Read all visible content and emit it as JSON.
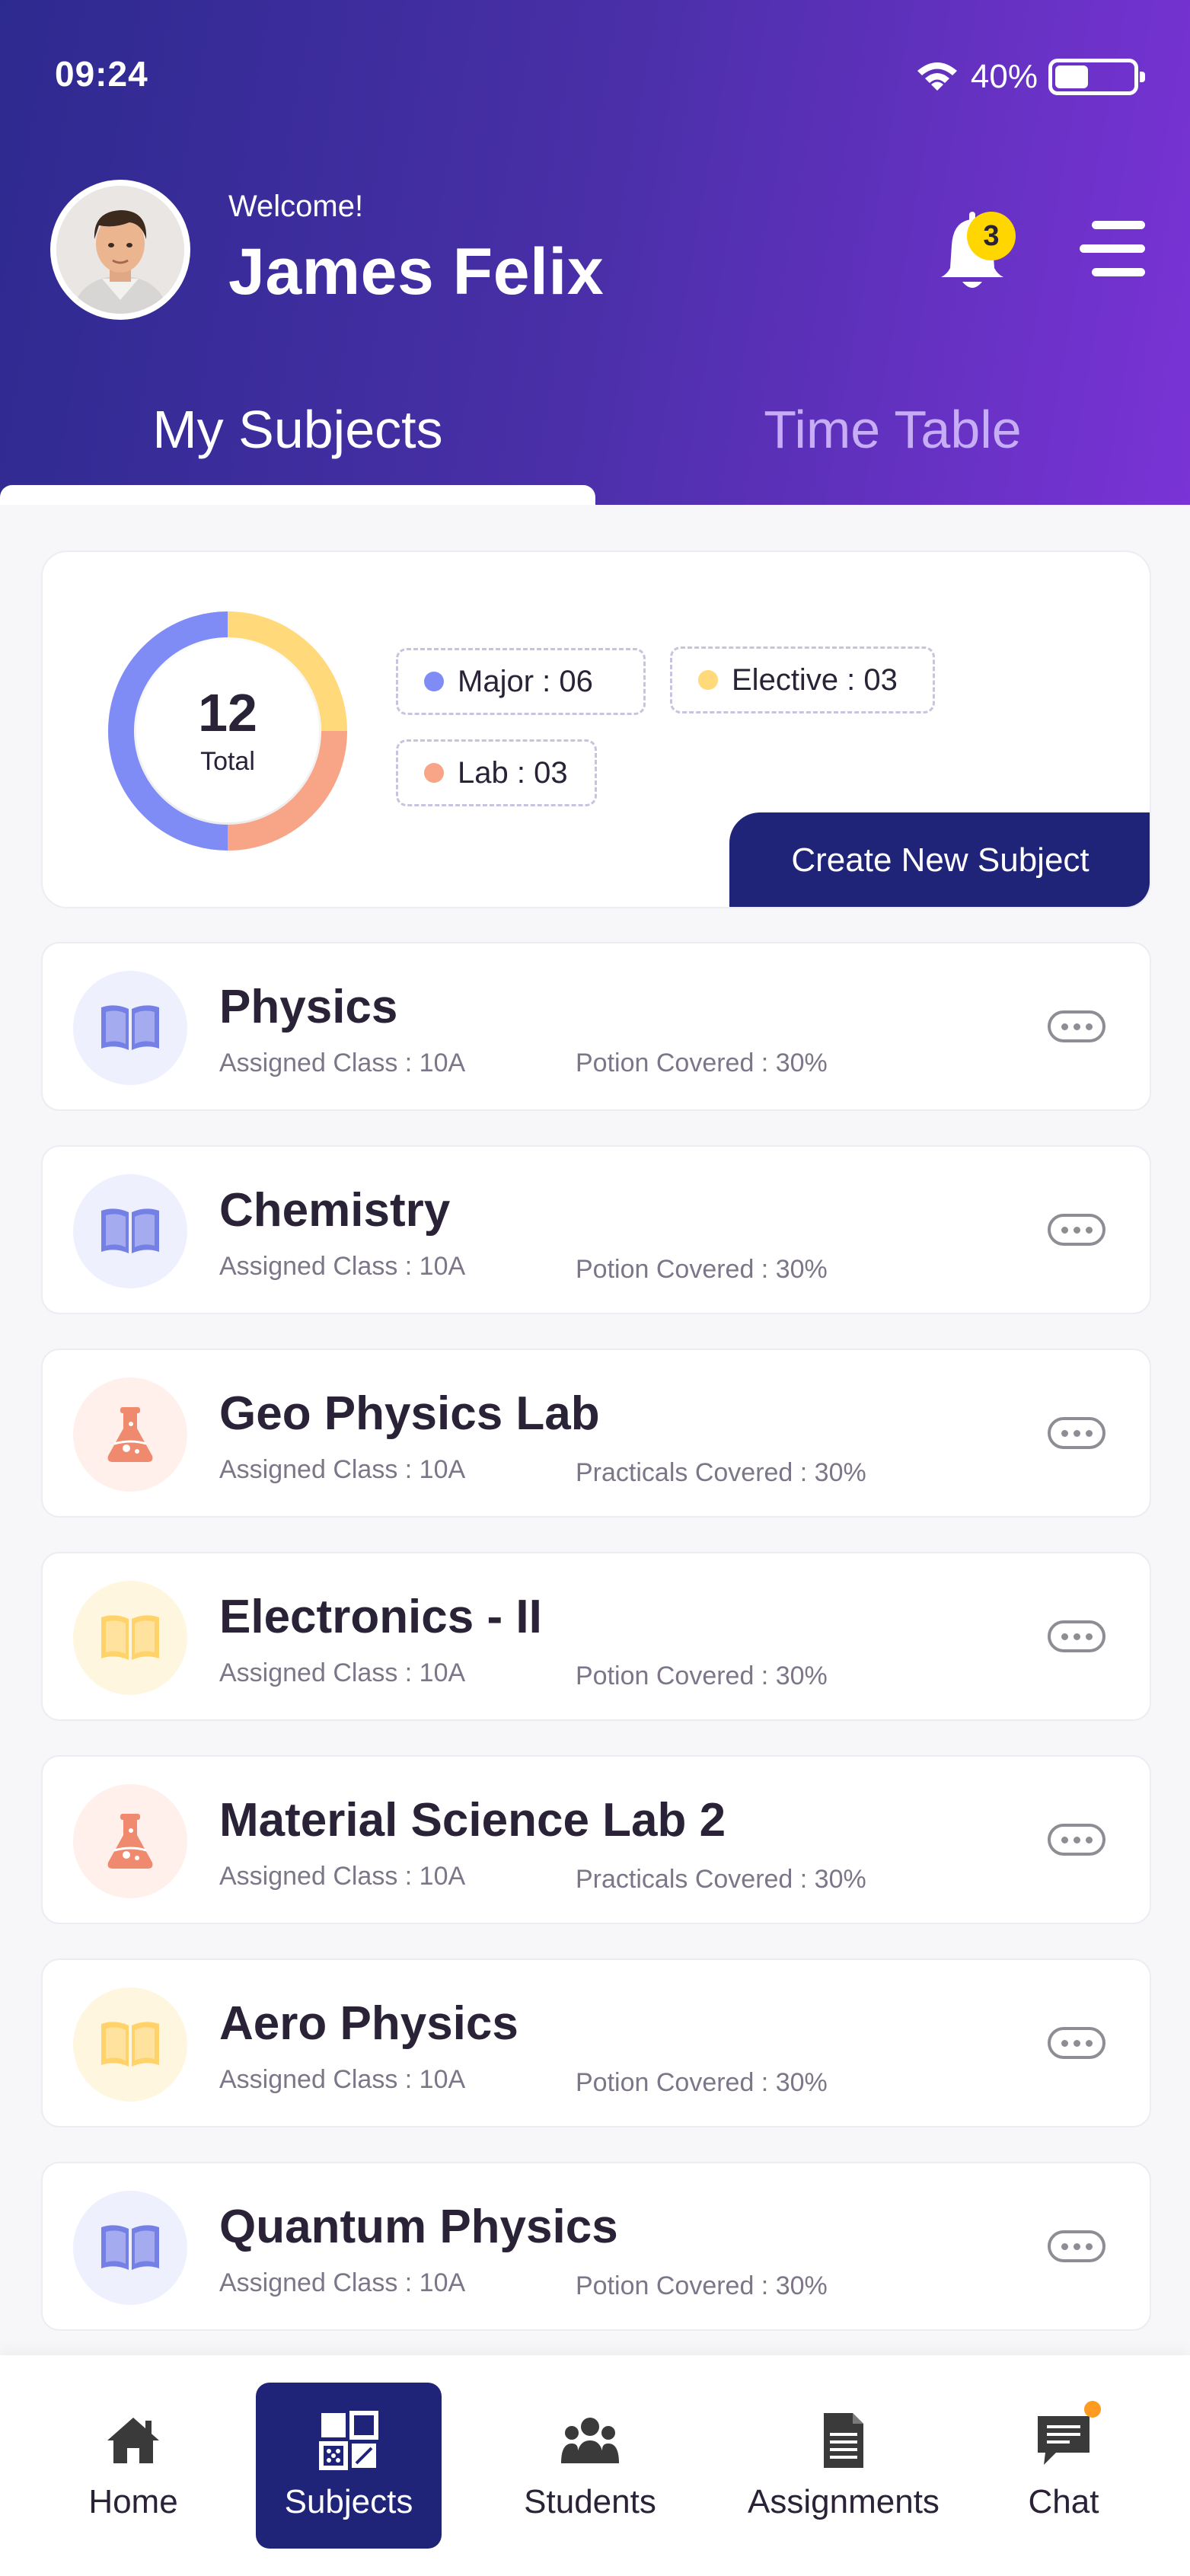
{
  "status": {
    "time": "09:24",
    "battery": "40%",
    "battery_level": 0.4
  },
  "profile": {
    "welcome": "Welcome!",
    "name": "James Felix",
    "notification_count": "3"
  },
  "tabs": [
    {
      "label": "My Subjects",
      "active": true
    },
    {
      "label": "Time Table",
      "active": false
    }
  ],
  "summary": {
    "total": "12",
    "total_label": "Total",
    "legend": [
      {
        "label": "Major : 06",
        "color": "#7f8cf6",
        "value": 6
      },
      {
        "label": "Elective : 03",
        "color": "#ffd97a",
        "value": 3
      },
      {
        "label": "Lab : 03",
        "color": "#f7a487",
        "value": 3
      }
    ],
    "create_label": "Create New Subject"
  },
  "subjects": [
    {
      "name": "Physics",
      "class": "Assigned Class : 10A",
      "progress": "Potion Covered : 30%",
      "icon": "book-icon",
      "theme": "blue"
    },
    {
      "name": "Chemistry",
      "class": "Assigned Class : 10A",
      "progress": "Potion Covered : 30%",
      "icon": "book-icon",
      "theme": "blue"
    },
    {
      "name": "Geo Physics Lab",
      "class": "Assigned Class : 10A",
      "progress": "Practicals Covered : 30%",
      "icon": "flask-icon",
      "theme": "orange"
    },
    {
      "name": "Electronics - II",
      "class": "Assigned Class : 10A",
      "progress": "Potion Covered : 30%",
      "icon": "book-icon",
      "theme": "yellow"
    },
    {
      "name": "Material Science Lab 2",
      "class": "Assigned Class : 10A",
      "progress": "Practicals Covered : 30%",
      "icon": "flask-icon",
      "theme": "orange"
    },
    {
      "name": "Aero Physics",
      "class": "Assigned Class : 10A",
      "progress": "Potion Covered : 30%",
      "icon": "book-icon",
      "theme": "yellow"
    },
    {
      "name": "Quantum Physics",
      "class": "Assigned Class : 10A",
      "progress": "Potion Covered : 30%",
      "icon": "book-icon",
      "theme": "blue"
    }
  ],
  "themes": {
    "blue": {
      "bg": "#eef0fd",
      "fg": "#7480e6"
    },
    "orange": {
      "bg": "#fff0ec",
      "fg": "#f08a6e"
    },
    "yellow": {
      "bg": "#fff6df",
      "fg": "#ffd36a"
    }
  },
  "nav": [
    {
      "label": "Home",
      "icon": "home-icon",
      "active": false
    },
    {
      "label": "Subjects",
      "icon": "subjects-icon",
      "active": true
    },
    {
      "label": "Students",
      "icon": "students-icon",
      "active": false
    },
    {
      "label": "Assignments",
      "icon": "assignments-icon",
      "active": false
    },
    {
      "label": "Chat",
      "icon": "chat-icon",
      "active": false
    }
  ],
  "colors": {
    "primary": "#1f2478",
    "notification_dot": "#ff9b21"
  }
}
